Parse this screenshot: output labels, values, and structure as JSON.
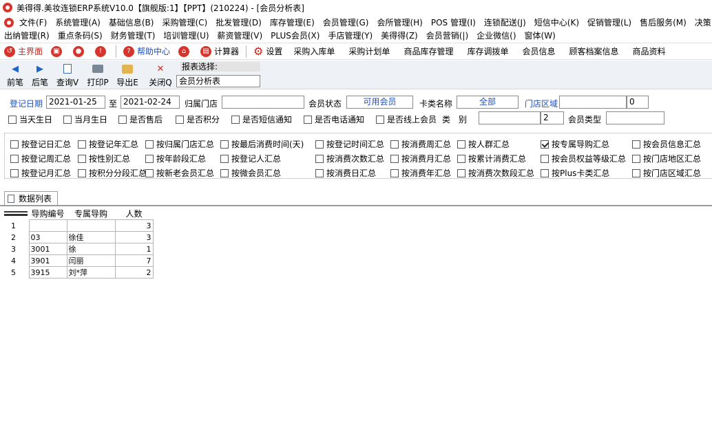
{
  "window": {
    "title": "美得得.美妆连锁ERP系统V10.0【旗舰版:1】【PPT】(210224) - [会员分析表]"
  },
  "menu_row1": [
    "文件(F)",
    "系统管理(A)",
    "基础信息(B)",
    "采购管理(C)",
    "批发管理(D)",
    "库存管理(E)",
    "会员管理(G)",
    "会所管理(H)",
    "POS 管理(I)",
    "连锁配送(J)",
    "短信中心(K)",
    "促销管理(L)",
    "售后服务(M)",
    "决策"
  ],
  "menu_row2": [
    "出纳管理(R)",
    "重点条码(S)",
    "财务管理(T)",
    "培训管理(U)",
    "薪资管理(V)",
    "PLUS会员(X)",
    "手店管理(Y)",
    "美得得(Z)",
    "会员营销(|)",
    "企业微信()",
    "窗体(W)"
  ],
  "toolbar": {
    "home": "主界面",
    "help": "帮助中心",
    "calc": "计算器",
    "settings": "设置",
    "links": [
      "采购入库单",
      "采购计划单",
      "商品库存管理",
      "库存调拨单",
      "会员信息",
      "顾客档案信息",
      "商品资料"
    ]
  },
  "actions": {
    "prev": "前笔",
    "next": "后笔",
    "query": "查询V",
    "print": "打印P",
    "export": "导出E",
    "close": "关闭Q"
  },
  "report": {
    "label": "报表选择:",
    "value": "会员分析表"
  },
  "filters": {
    "reg_date_label": "登记日期",
    "date_from": "2021-01-25",
    "to_label": "至",
    "date_to": "2021-02-24",
    "store_label": "归属门店",
    "store_value": "",
    "status_label": "会员状态",
    "status_value": "可用会员",
    "card_label": "卡类名称",
    "card_value": "全部",
    "region_label": "门店区域",
    "region_value": "",
    "region_code": "0",
    "checks": [
      "当天生日",
      "当月生日",
      "是否售后",
      "是否积分",
      "是否短信通知",
      "是否电话通知",
      "是否线上会员"
    ],
    "class_label": "类　别",
    "class_value": "",
    "class_code": "2",
    "member_type_label": "会员类型",
    "member_type_value": ""
  },
  "group_options": {
    "row1": [
      "按登记日汇总",
      "按登记年汇总",
      "按归属门店汇总",
      "按最后消费时间(天)",
      "按登记时间汇总",
      "按消费周汇总",
      "按人群汇总",
      "按专属导购汇总",
      "按会员信息汇总"
    ],
    "row2": [
      "按登记周汇总",
      "按性别汇总",
      "按年龄段汇总",
      "按登记人汇总",
      "按消费次数汇总",
      "按消费月汇总",
      "按累计消费汇总",
      "按会员权益等级汇总",
      "按门店地区汇总"
    ],
    "row3": [
      "按登记月汇总",
      "按积分分段汇总",
      "按新老会员汇总",
      "按微会员汇总",
      "按消费日汇总",
      "按消费年汇总",
      "按消费次数段汇总",
      "按Plus卡类汇总",
      "按门店区域汇总"
    ],
    "checked": "按专属导购汇总"
  },
  "tab": {
    "label": "数据列表"
  },
  "table": {
    "headers": [
      "导购编号",
      "专属导购",
      "人数"
    ],
    "rows": [
      {
        "no": "1",
        "code": "",
        "name": "",
        "count": "3"
      },
      {
        "no": "2",
        "code": "03",
        "name": "徐佳",
        "count": "3"
      },
      {
        "no": "3",
        "code": "3001",
        "name": "徐",
        "count": "1"
      },
      {
        "no": "4",
        "code": "3901",
        "name": "闫丽",
        "count": "7"
      },
      {
        "no": "5",
        "code": "3915",
        "name": "刘*萍",
        "count": "2"
      }
    ]
  },
  "colors": {
    "accent_red": "#d9342b",
    "label_blue": "#1f4fbf"
  }
}
